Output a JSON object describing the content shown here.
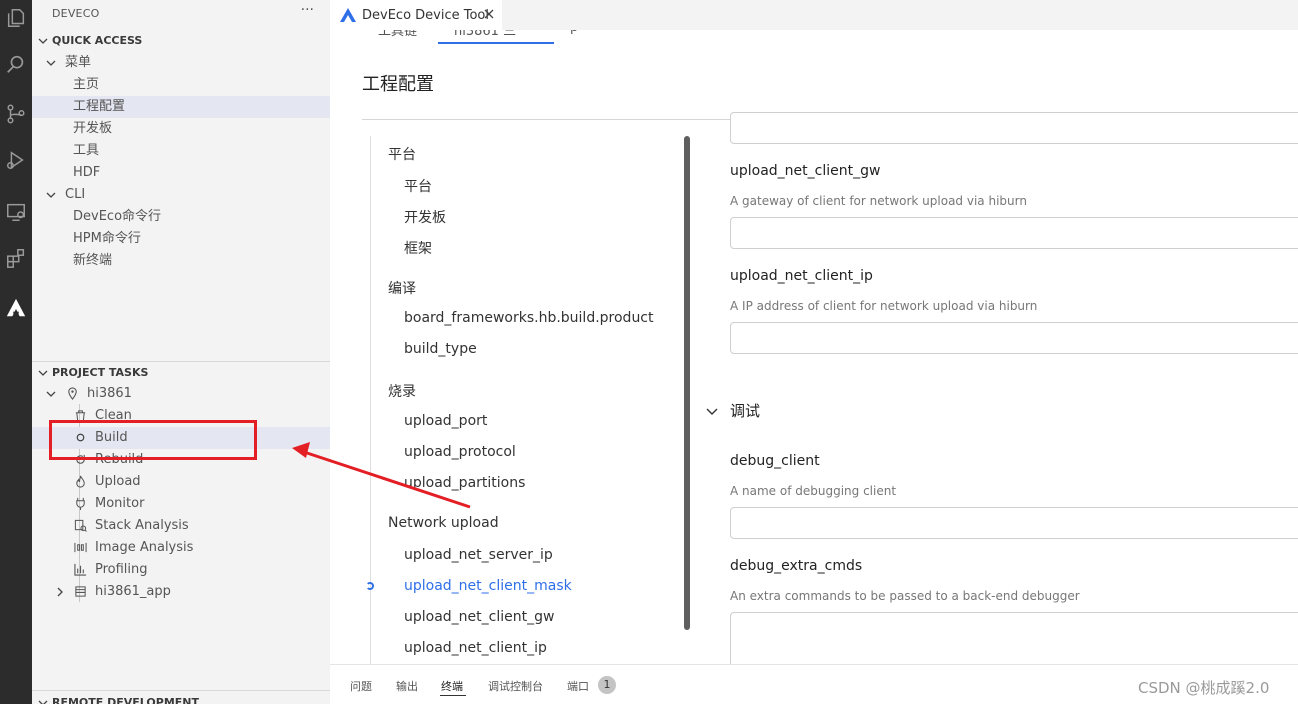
{
  "sidebar": {
    "title": "DEVECO",
    "more": "···",
    "quick_access": {
      "label": "QUICK ACCESS",
      "menu": {
        "label": "菜单",
        "items": [
          "主页",
          "工程配置",
          "开发板",
          "工具",
          "HDF"
        ]
      },
      "cli": {
        "label": "CLI",
        "items": [
          "DevEco命令行",
          "HPM命令行",
          "新终端"
        ]
      }
    },
    "project_tasks": {
      "label": "PROJECT TASKS",
      "project": "hi3861",
      "tasks": [
        "Clean",
        "Build",
        "Rebuild",
        "Upload",
        "Monitor",
        "Stack Analysis",
        "Image Analysis",
        "Profiling"
      ],
      "app": "hi3861_app"
    },
    "remote_development": "REMOTE DEVELOPMENT"
  },
  "editor_tab": {
    "label": "DevEco Device Tool"
  },
  "editor": {
    "title": "工程配置",
    "top_tab_fragments": [
      "工具链",
      "hi3861 三",
      "p"
    ],
    "nav": [
      {
        "type": "group",
        "label": "平台"
      },
      {
        "type": "sub",
        "label": "平台"
      },
      {
        "type": "sub",
        "label": "开发板"
      },
      {
        "type": "sub",
        "label": "框架"
      },
      {
        "type": "group",
        "label": "编译"
      },
      {
        "type": "sub",
        "label": "board_frameworks.hb.build.product"
      },
      {
        "type": "sub",
        "label": "build_type"
      },
      {
        "type": "group",
        "label": "烧录"
      },
      {
        "type": "sub",
        "label": "upload_port"
      },
      {
        "type": "sub",
        "label": "upload_protocol"
      },
      {
        "type": "sub",
        "label": "upload_partitions"
      },
      {
        "type": "group",
        "label": "Network upload"
      },
      {
        "type": "sub",
        "label": "upload_net_server_ip"
      },
      {
        "type": "sub",
        "label": "upload_net_client_mask",
        "active": true
      },
      {
        "type": "sub",
        "label": "upload_net_client_gw"
      },
      {
        "type": "sub",
        "label": "upload_net_client_ip"
      }
    ],
    "fields": {
      "gw": {
        "label": "upload_net_client_gw",
        "desc": "A gateway of client for network upload via hiburn",
        "value": ""
      },
      "ip": {
        "label": "upload_net_client_ip",
        "desc": "A IP address of client for network upload via hiburn",
        "value": ""
      },
      "debug_section": "调试",
      "debug_client": {
        "label": "debug_client",
        "desc": "A name of debugging client",
        "value": ""
      },
      "debug_extra": {
        "label": "debug_extra_cmds",
        "desc": "An extra commands to be passed to a back-end debugger",
        "value": ""
      }
    }
  },
  "panel": {
    "tabs": [
      "问题",
      "输出",
      "终端",
      "调试控制台",
      "端口"
    ],
    "active": "终端",
    "ports_badge": "1"
  },
  "watermark": "CSDN @桃成蹊2.0",
  "colors": {
    "accent": "#2f6fe8",
    "annotation": "#e31e24",
    "activity_bar": "#2c2c2c"
  }
}
